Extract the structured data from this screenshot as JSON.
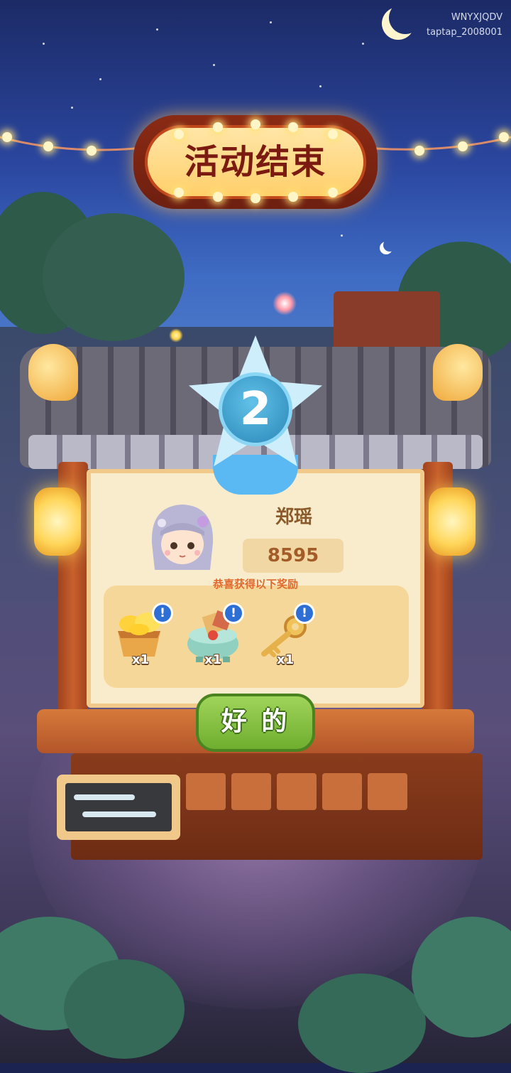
{
  "watermark": {
    "line1": "WNYXJQDV",
    "line2": "taptap_2008001"
  },
  "title": "活动结束",
  "rank": "2",
  "player": {
    "name": "郑瑶",
    "score": "8595"
  },
  "rewards_caption": "恭喜获得以下奖励",
  "rewards": [
    {
      "icon": "gold-ingot-bucket-icon",
      "qty": "x1"
    },
    {
      "icon": "treasure-censer-icon",
      "qty": "x1"
    },
    {
      "icon": "golden-key-icon",
      "qty": "x1"
    }
  ],
  "info_badge": "!",
  "confirm_label": "好 的",
  "colors": {
    "title_text": "#7a1a10",
    "button": "#8cc84b",
    "score_text": "#a25c28",
    "caption": "#e06a2e"
  }
}
